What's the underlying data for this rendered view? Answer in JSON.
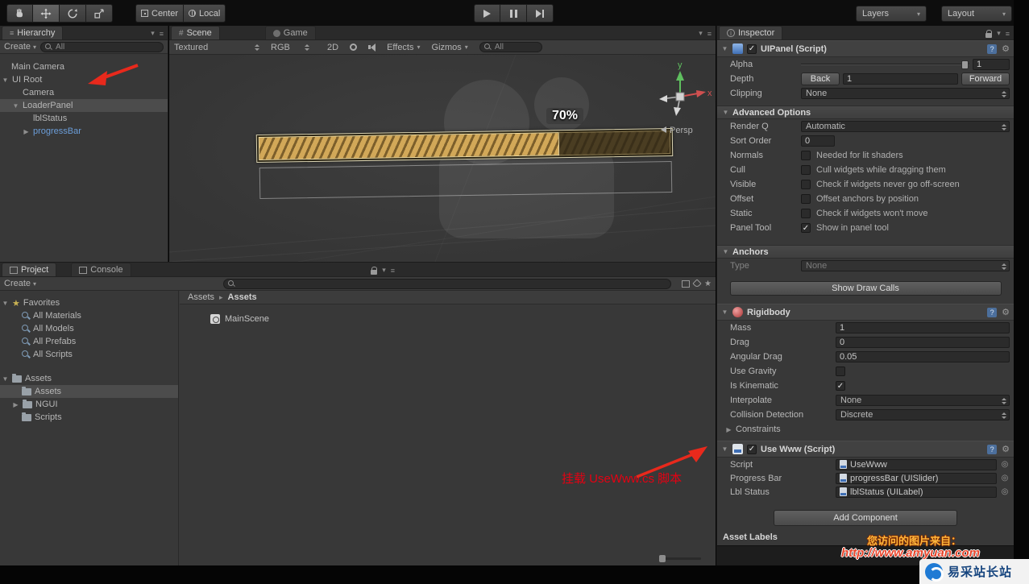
{
  "icons": {
    "fold_open": "▼",
    "fold_closed": "▶",
    "caret": "▾",
    "menu": "≡",
    "gear": "⚙",
    "star": "★",
    "help": "?",
    "picker": "◎",
    "crumb_sep": "▸",
    "hash": "#"
  },
  "toolbar": {
    "center": "Center",
    "local": "Local",
    "layers": "Layers",
    "layout": "Layout"
  },
  "hierarchy": {
    "tab": "Hierarchy",
    "create": "Create",
    "search": "All",
    "items": [
      {
        "label": "Main Camera"
      },
      {
        "label": "UI Root"
      },
      {
        "label": "Camera"
      },
      {
        "label": "LoaderPanel"
      },
      {
        "label": "lblStatus"
      },
      {
        "label": "progressBar"
      }
    ]
  },
  "scene": {
    "tab_scene": "Scene",
    "tab_game": "Game",
    "shading": "Textured",
    "channel": "RGB",
    "mode_2d": "2D",
    "effects": "Effects",
    "gizmos": "Gizmos",
    "search": "All",
    "progress_label": "70%",
    "axis_x": "x",
    "axis_y": "y",
    "persp": "Persp"
  },
  "project": {
    "tab_project": "Project",
    "tab_console": "Console",
    "create": "Create",
    "favorites_label": "Favorites",
    "favorites": [
      {
        "label": "All Materials"
      },
      {
        "label": "All Models"
      },
      {
        "label": "All Prefabs"
      },
      {
        "label": "All Scripts"
      }
    ],
    "assets_label": "Assets",
    "assets_children": [
      {
        "label": "Assets"
      },
      {
        "label": "NGUI"
      },
      {
        "label": "Scripts"
      }
    ],
    "breadcrumb_root": "Assets",
    "breadcrumb_current": "Assets",
    "files": [
      {
        "label": "MainScene"
      }
    ]
  },
  "inspector": {
    "tab": "Inspector",
    "uipanel": {
      "title": "UIPanel (Script)",
      "enabled": true,
      "alpha_label": "Alpha",
      "alpha_value": "1",
      "depth_label": "Depth",
      "back": "Back",
      "depth_value": "1",
      "forward": "Forward",
      "clipping_label": "Clipping",
      "clipping_value": "None",
      "advanced_title": "Advanced Options",
      "render_q_label": "Render Q",
      "render_q_value": "Automatic",
      "sort_order_label": "Sort Order",
      "sort_order_value": "0",
      "checks": [
        {
          "label": "Normals",
          "desc": "Needed for lit shaders",
          "checked": false
        },
        {
          "label": "Cull",
          "desc": "Cull widgets while dragging them",
          "checked": false
        },
        {
          "label": "Visible",
          "desc": "Check if widgets never go off-screen",
          "checked": false
        },
        {
          "label": "Offset",
          "desc": "Offset anchors by position",
          "checked": false
        },
        {
          "label": "Static",
          "desc": "Check if widgets won't move",
          "checked": false
        },
        {
          "label": "Panel Tool",
          "desc": "Show in panel tool",
          "checked": true
        }
      ],
      "anchors_title": "Anchors",
      "type_label": "Type",
      "type_value": "None",
      "show_draw_calls": "Show Draw Calls"
    },
    "rigidbody": {
      "title": "Rigidbody",
      "mass_label": "Mass",
      "mass_value": "1",
      "drag_label": "Drag",
      "drag_value": "0",
      "angular_drag_label": "Angular Drag",
      "angular_drag_value": "0.05",
      "use_gravity_label": "Use Gravity",
      "use_gravity": false,
      "is_kinematic_label": "Is Kinematic",
      "is_kinematic": true,
      "interpolate_label": "Interpolate",
      "interpolate_value": "None",
      "collision_label": "Collision Detection",
      "collision_value": "Discrete",
      "constraints_label": "Constraints"
    },
    "usewww": {
      "title": "Use Www (Script)",
      "enabled": true,
      "script_label": "Script",
      "script_value": "UseWww",
      "progress_label": "Progress Bar",
      "progress_value": "progressBar (UISlider)",
      "status_label": "Lbl Status",
      "status_value": "lblStatus (UILabel)"
    },
    "add_component": "Add Component",
    "asset_labels": "Asset Labels"
  },
  "annotation": {
    "note": "挂载 UseWww.cs 脚本"
  },
  "watermark": {
    "source_line": "您访问的图片来自：",
    "url": "http://www.amyuan.com",
    "logo": "易采站长站"
  }
}
